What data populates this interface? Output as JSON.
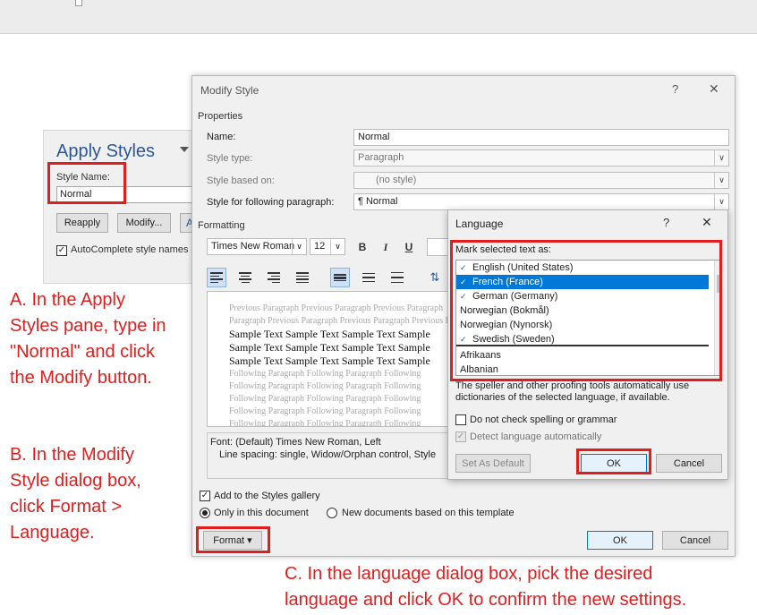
{
  "topbar": {},
  "apply_styles": {
    "title": "Apply Styles",
    "style_name_label": "Style Name:",
    "style_name_value": "Normal",
    "reapply_label": "Reapply",
    "modify_label": "Modify...",
    "extra_label": "A",
    "autocomplete_label": "AutoComplete style names"
  },
  "modify_style": {
    "title": "Modify Style",
    "help": "?",
    "close": "✕",
    "properties_heading": "Properties",
    "name_label": "Name:",
    "name_value": "Normal",
    "style_type_label": "Style type:",
    "style_type_value": "Paragraph",
    "based_on_label": "Style based on:",
    "based_on_value": "(no style)",
    "following_label": "Style for following paragraph:",
    "following_value": "¶  Normal",
    "formatting_heading": "Formatting",
    "font_name": "Times New Roman",
    "font_size": "12",
    "bold": "B",
    "italic": "I",
    "underline": "U",
    "preview_previous": [
      "Previous Paragraph Previous Paragraph Previous Paragraph",
      "Paragraph Previous Paragraph Previous Paragraph Previous Pa"
    ],
    "preview_sample": [
      "Sample Text Sample Text Sample Text Sample",
      "Sample Text Sample Text Sample Text Sample",
      "Sample Text Sample Text Sample Text Sample"
    ],
    "preview_following": [
      "Following Paragraph Following Paragraph Following",
      "Following Paragraph Following Paragraph Following",
      "Following Paragraph Following Paragraph Following",
      "Following Paragraph Following Paragraph Following",
      "Following Paragraph Following Paragraph Following"
    ],
    "description_line1": "Font: (Default) Times New Roman, Left",
    "description_line2": "Line spacing:  single, Widow/Orphan control, Style",
    "add_to_gallery": "Add to the Styles gallery",
    "only_this_doc": "Only in this document",
    "new_docs": "New documents based on this template",
    "format_button": "Format ▾",
    "ok": "OK",
    "cancel": "Cancel"
  },
  "language_dialog": {
    "title": "Language",
    "help": "?",
    "close": "✕",
    "mark_label": "Mark selected text as:",
    "languages": [
      {
        "name": "English (United States)",
        "spell": true,
        "selected": false
      },
      {
        "name": "French (France)",
        "spell": true,
        "selected": true
      },
      {
        "name": "German (Germany)",
        "spell": true,
        "selected": false
      },
      {
        "name": "Norwegian (Bokmål)",
        "spell": false,
        "selected": false
      },
      {
        "name": "Norwegian (Nynorsk)",
        "spell": false,
        "selected": false
      },
      {
        "name": "Swedish (Sweden)",
        "spell": true,
        "selected": false
      },
      {
        "name": "Afrikaans",
        "spell": false,
        "selected": false
      },
      {
        "name": "Albanian",
        "spell": false,
        "selected": false
      }
    ],
    "info_line1": "The speller and other proofing tools automatically use",
    "info_line2": "dictionaries of the selected language, if available.",
    "no_spell_check": "Do not check spelling or grammar",
    "detect_auto": "Detect language automatically",
    "set_default": "Set As Default",
    "ok": "OK",
    "cancel": "Cancel"
  },
  "annotations": {
    "a": [
      "A. In the Apply",
      "Styles pane, type in",
      "\"Normal\" and click",
      "the Modify button."
    ],
    "b": [
      "B. In the Modify",
      "Style dialog box,",
      "click Format >",
      "Language."
    ],
    "c": [
      "C. In the language dialog box, pick the desired",
      "language and click OK to confirm the new settings."
    ]
  },
  "colors": {
    "annotation_red": "#e01e1e",
    "selection_blue": "#0078d7",
    "title_blue": "#2b579a"
  }
}
